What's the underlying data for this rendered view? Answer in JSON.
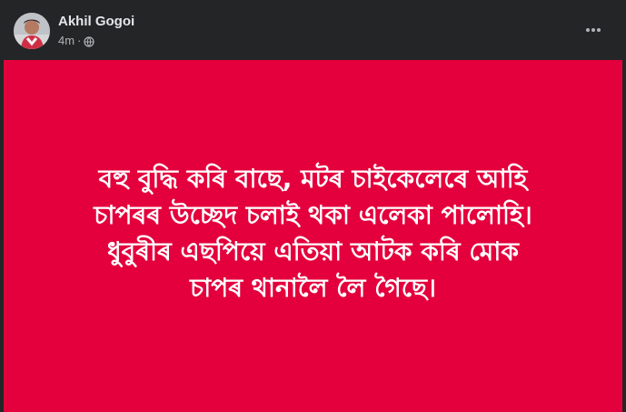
{
  "post": {
    "author": "Akhil Gogoi",
    "time": "4m",
    "separator": "·",
    "audience_icon": "globe-icon",
    "menu_icon": "more-options-icon",
    "background_color": "#e3003c",
    "text_lines": [
      "বহু বুদ্ধি কৰি বাছে, মটৰ চাইকেলেৰে আহি",
      "চাপৰৰ উচ্ছেদ চলাই থকা এলেকা পালোহি।",
      "ধুবুৰীৰ এছপিয়ে এতিয়া আটক কৰি মোক",
      "চাপৰ থানালৈ লৈ গৈছে।"
    ]
  }
}
